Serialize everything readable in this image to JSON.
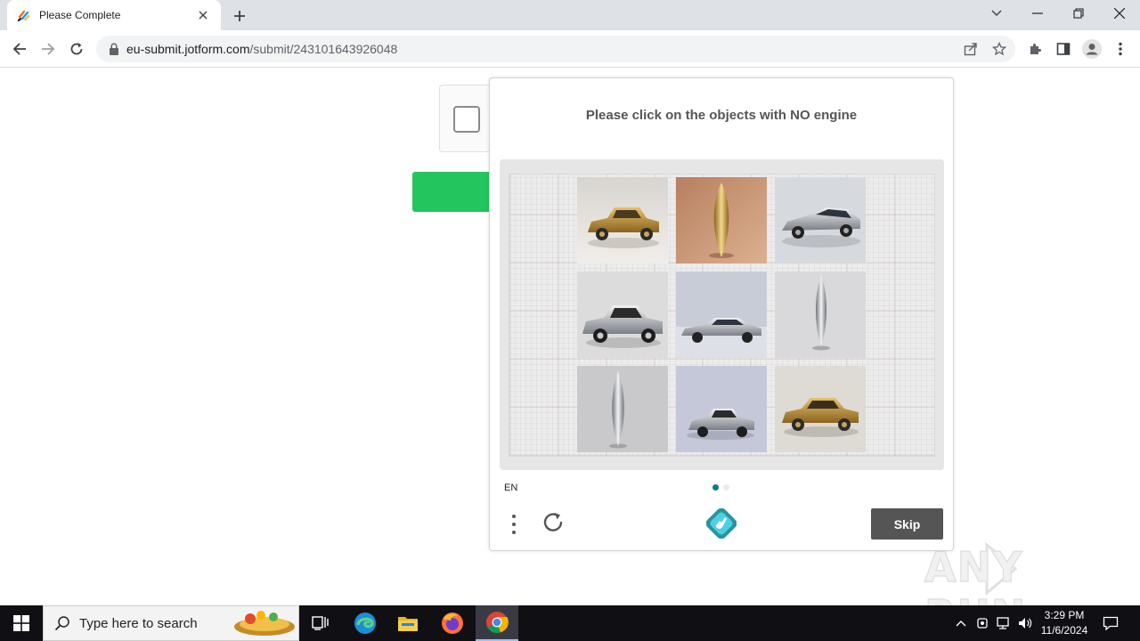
{
  "browser": {
    "tab_title": "Please Complete",
    "url_host": "eu-submit.jotform.com",
    "url_path": "/submit/243101643926048"
  },
  "captcha": {
    "prompt": "Please click on the objects with NO engine",
    "tiles": [
      {
        "subject": "gold vintage car"
      },
      {
        "subject": "gold oval object"
      },
      {
        "subject": "silver sports car"
      },
      {
        "subject": "silver vintage car"
      },
      {
        "subject": "silver sedan car"
      },
      {
        "subject": "silver oval object"
      },
      {
        "subject": "silver oval object"
      },
      {
        "subject": "silver vintage car"
      },
      {
        "subject": "gold vintage car"
      }
    ],
    "language": "EN",
    "page_count": 2,
    "active_page": 1,
    "skip_label": "Skip"
  },
  "watermark": {
    "text": "ANY RUN"
  },
  "taskbar": {
    "search_placeholder": "Type here to search",
    "time": "3:29 PM",
    "date": "11/6/2024"
  },
  "colors": {
    "submit_green": "#22c55e",
    "hcaptcha_teal": "#0a7a8a",
    "skip_bg": "#555555"
  }
}
